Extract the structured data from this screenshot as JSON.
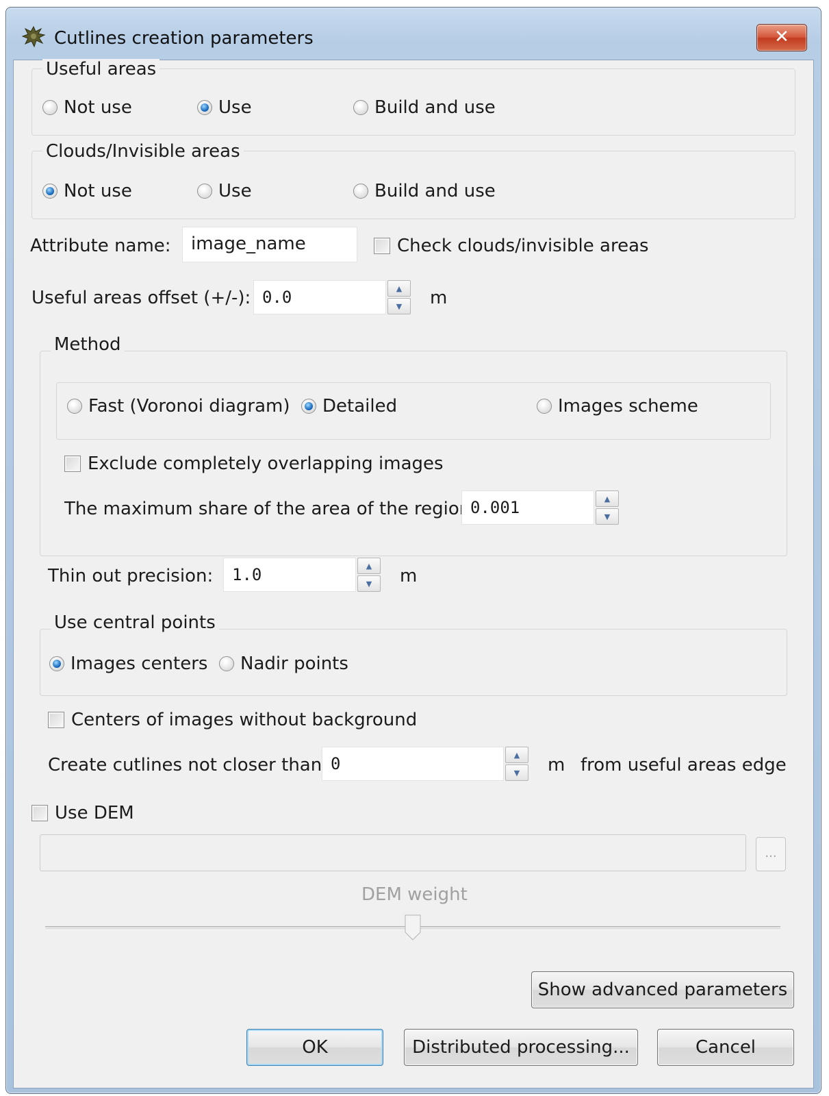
{
  "window": {
    "title": "Cutlines creation parameters",
    "close_glyph": "✕"
  },
  "useful_areas": {
    "legend": "Useful areas",
    "options": [
      "Not use",
      "Use",
      "Build and use"
    ],
    "selected": "Use"
  },
  "clouds": {
    "legend": "Clouds/Invisible areas",
    "options": [
      "Not use",
      "Use",
      "Build and use"
    ],
    "selected": "Not use"
  },
  "attribute": {
    "label": "Attribute name:",
    "value": "image_name",
    "check_clouds_label": "Check clouds/invisible areas",
    "check_clouds_checked": false
  },
  "offset": {
    "label": "Useful areas offset (+/-):",
    "value": "0.0",
    "unit": "m"
  },
  "method": {
    "legend": "Method",
    "options": [
      "Fast (Voronoi diagram)",
      "Detailed",
      "Images scheme"
    ],
    "selected": "Detailed",
    "exclude_label": "Exclude completely overlapping images",
    "exclude_checked": false,
    "max_share_label": "The maximum share of the area of the region",
    "max_share_value": "0.001"
  },
  "thin_out": {
    "label": "Thin out precision:",
    "value": "1.0",
    "unit": "m"
  },
  "central_points": {
    "legend": "Use central points",
    "options": [
      "Images centers",
      "Nadir points"
    ],
    "selected": "Images centers"
  },
  "centers_without_bg": {
    "label": "Centers of images without background",
    "checked": false
  },
  "not_closer": {
    "label": "Create cutlines not closer than",
    "value": "0",
    "unit": "m",
    "suffix": "from useful areas edge"
  },
  "dem": {
    "use_label": "Use DEM",
    "checked": false,
    "path_value": "",
    "browse_label": "...",
    "weight_label": "DEM weight",
    "weight_fraction": 0.5
  },
  "buttons": {
    "advanced": "Show advanced parameters",
    "ok": "OK",
    "distributed": "Distributed processing...",
    "cancel": "Cancel"
  },
  "icons": {
    "spin_up": "▲",
    "spin_down": "▼",
    "app_icon": "gear-leaf-icon"
  }
}
